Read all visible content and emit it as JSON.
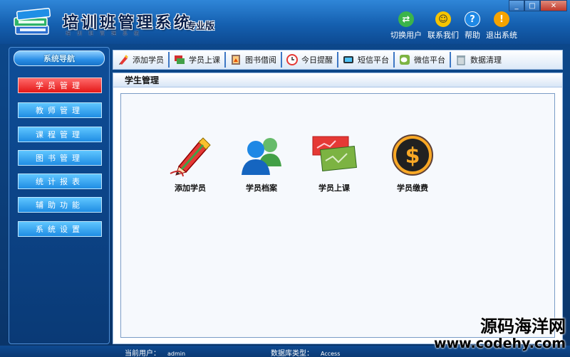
{
  "app": {
    "title": "培训班管理系统",
    "edition": "专业版",
    "subtitle": "培训班管理系统"
  },
  "window_controls": {
    "minimize": "_",
    "restore": "□",
    "close": "✕"
  },
  "header_actions": [
    {
      "label": "切换用户",
      "icon": "switch-user-icon",
      "color": "#3bb44a"
    },
    {
      "label": "联系我们",
      "icon": "contact-icon",
      "color": "#f5c400"
    },
    {
      "label": "帮助",
      "icon": "help-icon",
      "color": "#1e88e5"
    },
    {
      "label": "退出系统",
      "icon": "exit-icon",
      "color": "#f5a300"
    }
  ],
  "sidebar": {
    "header": "系统导航",
    "items": [
      {
        "label": "学员管理",
        "active": true
      },
      {
        "label": "教师管理",
        "active": false
      },
      {
        "label": "课程管理",
        "active": false
      },
      {
        "label": "图书管理",
        "active": false
      },
      {
        "label": "统计报表",
        "active": false
      },
      {
        "label": "辅助功能",
        "active": false
      },
      {
        "label": "系统设置",
        "active": false
      }
    ]
  },
  "toolbar": {
    "items": [
      {
        "label": "添加学员",
        "icon": "pencil-icon"
      },
      {
        "label": "学员上课",
        "icon": "class-icon"
      },
      {
        "label": "图书借阅",
        "icon": "book-icon"
      },
      {
        "label": "今日提醒",
        "icon": "clock-icon"
      },
      {
        "label": "短信平台",
        "icon": "sms-icon"
      },
      {
        "label": "微信平台",
        "icon": "wechat-icon"
      },
      {
        "label": "数据清理",
        "icon": "trash-icon"
      }
    ]
  },
  "panel": {
    "title": "学生管理",
    "tiles": [
      {
        "label": "添加学员",
        "icon": "add-student-icon"
      },
      {
        "label": "学员档案",
        "icon": "student-records-icon"
      },
      {
        "label": "学员上课",
        "icon": "student-class-icon"
      },
      {
        "label": "学员缴费",
        "icon": "payment-icon"
      }
    ]
  },
  "status": {
    "user_label": "当前用户：",
    "user_value": "admin",
    "db_label": "数据库类型：",
    "db_value": "Access"
  },
  "watermark": {
    "cn": "源码海洋网",
    "en": "www.codehy.com"
  }
}
